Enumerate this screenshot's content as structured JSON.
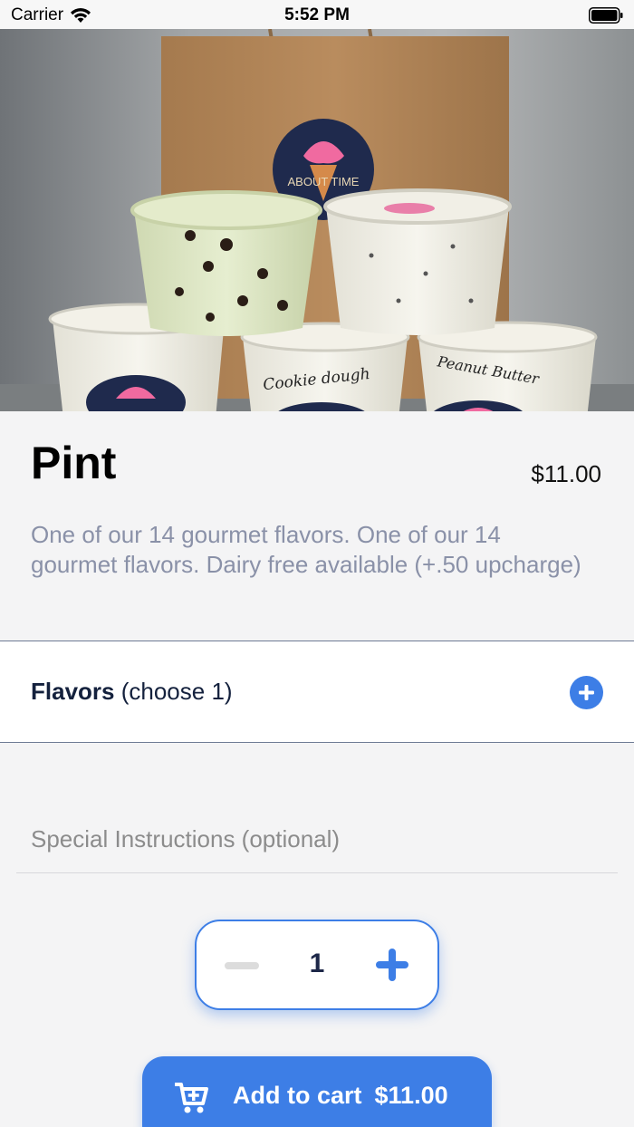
{
  "status_bar": {
    "carrier": "Carrier",
    "time": "5:52 PM"
  },
  "hero": {
    "logo_text": "ABOUT TIME",
    "label_cookie": "Cookie dough",
    "label_peanut": "Peanut Butter"
  },
  "product": {
    "title": "Pint",
    "price": "$11.00",
    "description": "One of our 14 gourmet flavors. One of our 14 gourmet flavors. Dairy free available (+.50 upcharge)"
  },
  "flavors": {
    "label": "Flavors",
    "hint": " (choose 1)"
  },
  "instructions": {
    "placeholder": "Special Instructions (optional)",
    "value": ""
  },
  "quantity": {
    "value": "1"
  },
  "cart_button": {
    "label": "Add to cart",
    "price": "$11.00"
  },
  "colors": {
    "accent": "#3d7ee6",
    "muted_text": "#8a91a8",
    "dark_text": "#14213d"
  }
}
